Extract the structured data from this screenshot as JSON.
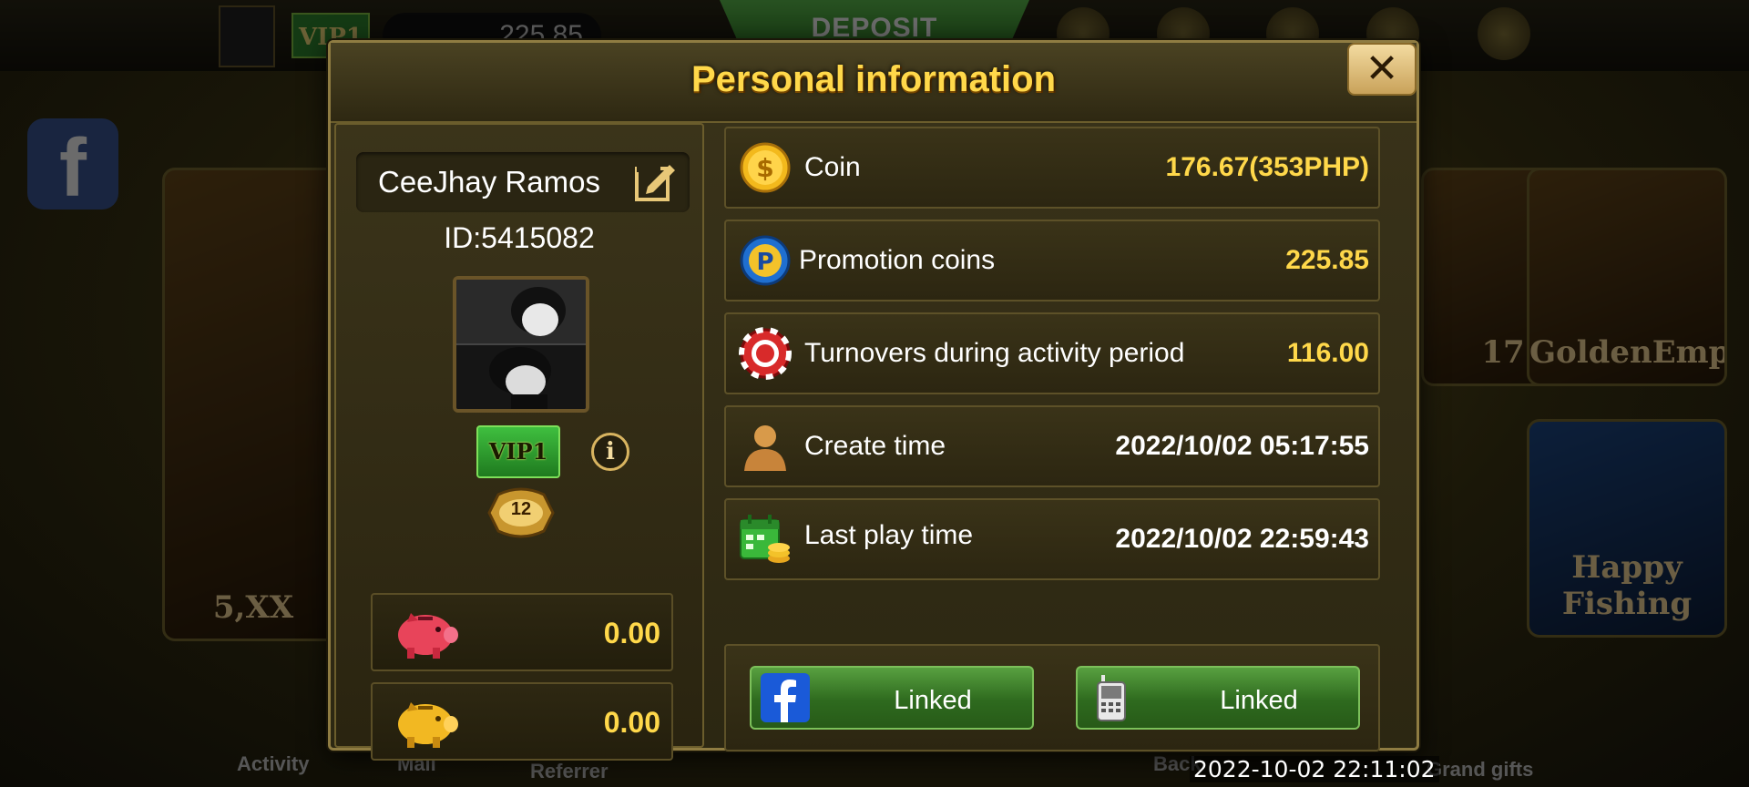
{
  "background": {
    "top_vip": "VIP1",
    "top_balance": "225.85",
    "deposit_label": "DEPOSIT",
    "game_labels": [
      "5,XX",
      "17",
      "GoldenEmpire",
      "Happy Fishing"
    ],
    "nav_labels": [
      "Activity",
      "Mail",
      "Referrer",
      "Back",
      "Grand gifts"
    ]
  },
  "modal": {
    "title": "Personal information",
    "close_label": "✕"
  },
  "profile": {
    "name": "CeeJhay Ramos",
    "id_label": "ID:5415082",
    "vip_label": "VIP1",
    "info_label": "i",
    "level": "12",
    "wallet_rows": [
      {
        "icon": "pink-piggy-bank-icon",
        "amount": "0.00"
      },
      {
        "icon": "gold-piggy-bank-icon",
        "amount": "0.00"
      }
    ]
  },
  "stats": [
    {
      "icon": "coin-icon",
      "label": "Coin",
      "value": "176.67(353PHP)",
      "color": "gold"
    },
    {
      "icon": "promotion-coin-icon",
      "label": "Promotion coins",
      "value": "225.85",
      "color": "gold"
    },
    {
      "icon": "poker-chip-icon",
      "label": "Turnovers during activity period",
      "value": "116.00",
      "color": "gold"
    },
    {
      "icon": "user-icon",
      "label": "Create time",
      "value": "2022/10/02 05:17:55",
      "color": "white"
    },
    {
      "icon": "calendar-coins-icon",
      "label": "Last play time",
      "value": "2022/10/02 22:59:43",
      "color": "white"
    }
  ],
  "links": {
    "facebook_label": "Linked",
    "phone_label": "Linked"
  },
  "status_timestamp": "2022-10-02 22:11:02",
  "colors": {
    "accent_gold": "#ffd84a",
    "panel_bg": "#2c2712",
    "link_green": "#2e6a1e"
  }
}
